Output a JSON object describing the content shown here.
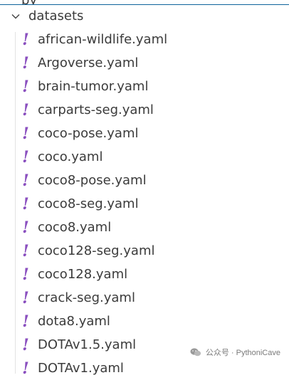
{
  "explorer": {
    "partial_top_label": "py",
    "folder": {
      "name": "datasets",
      "expanded": true
    },
    "files": [
      "african-wildlife.yaml",
      "Argoverse.yaml",
      "brain-tumor.yaml",
      "carparts-seg.yaml",
      "coco-pose.yaml",
      "coco.yaml",
      "coco8-pose.yaml",
      "coco8-seg.yaml",
      "coco8.yaml",
      "coco128-seg.yaml",
      "coco128.yaml",
      "crack-seg.yaml",
      "dota8.yaml",
      "DOTAv1.5.yaml",
      "DOTAv1.yaml"
    ],
    "file_icon_glyph": "!",
    "file_icon_name": "yaml-icon",
    "colors": {
      "yaml_icon": "#8a4fbf",
      "focus_border": "#0e639c",
      "text": "#3b3b3b"
    }
  },
  "watermark": {
    "text": "公众号 · PythoniCave",
    "icon": "wechat-icon"
  }
}
